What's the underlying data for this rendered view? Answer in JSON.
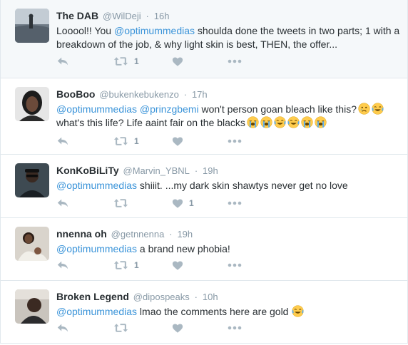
{
  "tweets": [
    {
      "fullname": "The DAB",
      "username": "@WilDeji",
      "time": "16h",
      "line1_prefix": "Looool!! You ",
      "line1_mention": "@optimummedias",
      "line1_suffix": " shoulda done the tweets in two parts; 1 with a",
      "line2": "breakdown of the job, & why light skin is best, THEN, the offer...",
      "retweet_count": "1",
      "like_count": ""
    },
    {
      "fullname": "BooBoo",
      "username": "@bukenkebukenzo",
      "time": "17h",
      "mention1": "@optimummedias",
      "mention2": "@prinzgbemi",
      "line1_suffix": " won't person goan bleach like this?",
      "line2": "what's this life? Life aaint fair on the blacks",
      "retweet_count": "1",
      "like_count": ""
    },
    {
      "fullname": "KonKoBiLiTy",
      "username": "@Marvin_YBNL",
      "time": "19h",
      "mention": "@optimummedias",
      "text": " shiiit. ...my dark skin shawtys never get no love",
      "retweet_count": "",
      "like_count": "1"
    },
    {
      "fullname": "nnenna oh",
      "username": "@getnnenna",
      "time": "19h",
      "mention": "@optimummedias",
      "text": " a brand new phobia!",
      "retweet_count": "1",
      "like_count": ""
    },
    {
      "fullname": "Broken Legend",
      "username": "@dipospeaks",
      "time": "10h",
      "mention": "@optimummedias",
      "text": " lmao the comments here are gold",
      "retweet_count": "",
      "like_count": ""
    }
  ],
  "separator": "·",
  "colors": {
    "accent_link": "#3b94d9",
    "meta_gray": "#8899a6",
    "border": "#e1e8ed",
    "highlight_bg": "#f5f8fa"
  },
  "icons": [
    "reply-icon",
    "retweet-icon",
    "heart-icon",
    "more-icon",
    "crying-emoji",
    "sobbing-emoji",
    "laughing-emoji"
  ]
}
